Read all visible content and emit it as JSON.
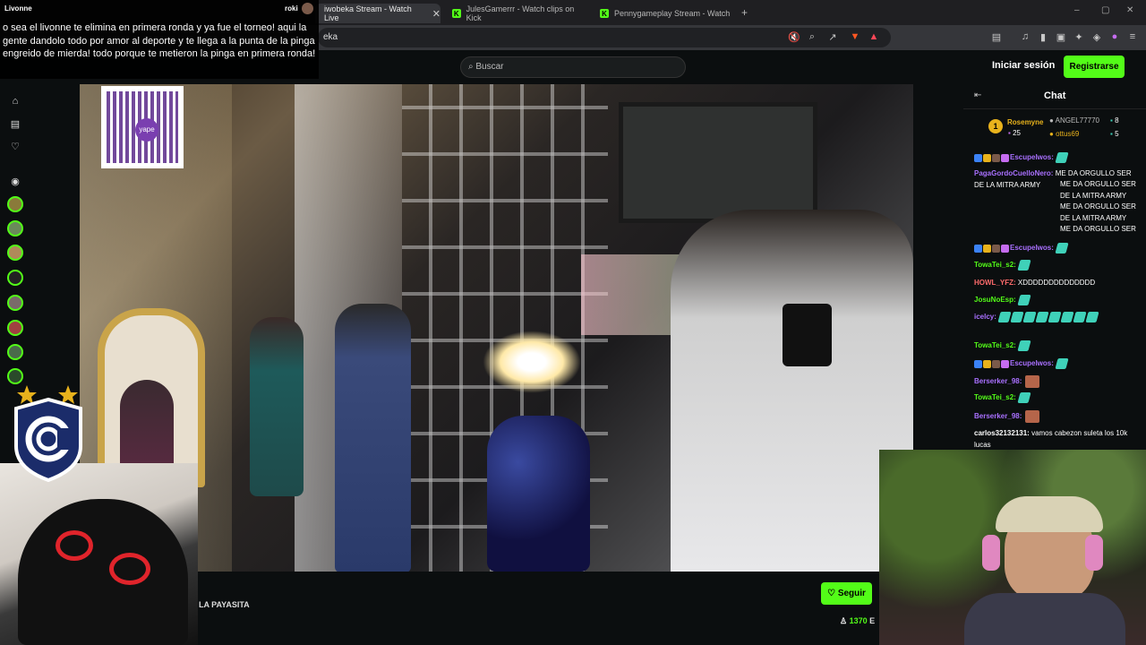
{
  "browser": {
    "tabs": [
      {
        "title": "iwobeka Stream - Watch Live",
        "active": true
      },
      {
        "title": "JulesGamerrr - Watch clips on Kick",
        "active": false
      },
      {
        "title": "Pennygameplay Stream - Watch",
        "active": false
      }
    ],
    "new_tab": "+",
    "url": "eka"
  },
  "header": {
    "search_placeholder": "Buscar",
    "login_label": "Iniciar sesión",
    "signup_label": "Registrarse"
  },
  "stream": {
    "title_fragment": "LA PAYASITA",
    "follow_label": "Seguir",
    "viewers": "1370",
    "viewers_suffix": "E"
  },
  "chat": {
    "title": "Chat",
    "top_gifters": [
      {
        "rank": "1",
        "name": "Rosemyne",
        "count": "25"
      },
      {
        "name": "ANGEL77770",
        "count": "8"
      },
      {
        "name": "ottus69",
        "count": "5"
      }
    ],
    "messages": [
      {
        "user": "Escupelwos:",
        "text": "",
        "color": "#a970ff",
        "emotes": 1
      },
      {
        "user": "PagaGordoCuelloNero:",
        "text": "ME DA ORGULLO SER DE LA MITRA ARMY",
        "color": "#a970ff",
        "emotes": 0
      },
      {
        "user": "",
        "text": "ME DA ORGULLO SER DE LA MITRA ARMY ME DA ORGULLO SER DE LA MITRA ARMY ME DA ORGULLO SER DE LA MITRA ARMY ME DA ORGULLO SER DE LA MITRA ARMY ME DA ORGULLO SER DE LA MITRA ARMY",
        "color": "#fff",
        "emotes": 0
      },
      {
        "user": "Escupelwos:",
        "text": "",
        "color": "#a970ff",
        "emotes": 1
      },
      {
        "user": "TowaTei_s2:",
        "text": "",
        "color": "#53fc18",
        "emotes": 1
      },
      {
        "user": "HOWL_YFZ:",
        "text": "XDDDDDDDDDDDDDD",
        "color": "#ff6b6b",
        "emotes": 0
      },
      {
        "user": "JosuNoEsp:",
        "text": "",
        "color": "#53fc18",
        "emotes": 1
      },
      {
        "user": "icelcy:",
        "text": "",
        "color": "#a970ff",
        "emotes": 8
      },
      {
        "user": "TowaTei_s2:",
        "text": "",
        "color": "#53fc18",
        "emotes": 1
      },
      {
        "user": "Escupelwos:",
        "text": "",
        "color": "#a970ff",
        "emotes": 1
      },
      {
        "user": "Berserker_98:",
        "text": "",
        "color": "#a970ff",
        "emotes": 0
      },
      {
        "user": "TowaTei_s2:",
        "text": "",
        "color": "#53fc18",
        "emotes": 1
      },
      {
        "user": "Berserker_98:",
        "text": "",
        "color": "#a970ff",
        "emotes": 0
      },
      {
        "user": "carlos32132131:",
        "text": "vamos cabezon suleta los 10k lucas",
        "color": "#fff",
        "emotes": 0
      }
    ]
  },
  "overlay": {
    "name": "Livonne",
    "user": "roki",
    "text": "o sea el livonne te elimina en primera ronda y ya fue el torneo! aqui la gente dandolo todo por amor al deporte y te llega a la punta de la pinga engreido de mierda! todo porque te metieron la pinga en primera ronda!"
  },
  "qr": {
    "label": "yape"
  },
  "colors": {
    "accent": "#53fc18",
    "bg": "#0b0e0f"
  }
}
